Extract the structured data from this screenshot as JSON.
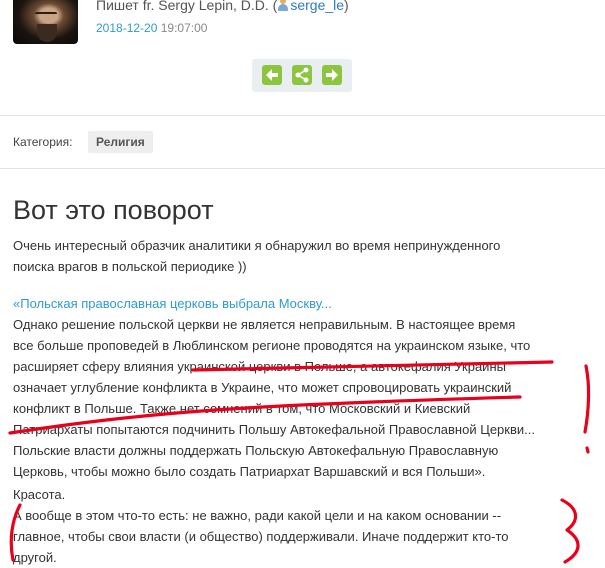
{
  "author": {
    "prefix": "Пишет fr. Sergy Lepin, D.D. (",
    "username": "serge_le",
    "suffix": ")",
    "date": "2018-12-20",
    "time": "19:07:00"
  },
  "share_bar": {
    "prev_icon": "arrow-left-icon",
    "share_icon": "share-icon",
    "next_icon": "arrow-right-icon",
    "accent": "#8cc63f"
  },
  "category": {
    "label": "Категория:",
    "value": "Религия"
  },
  "post": {
    "title": "Вот это поворот",
    "intro_lines": [
      "Очень интересный образчик аналитики я обнаружил во время непринужденного",
      "поиска врагов в польской периодике ))"
    ],
    "quote_link": "«Польская православная церковь выбрала Москву...",
    "quote_lines": [
      "Однако решение польской церкви не является неправильным. В настоящее время",
      "все больше проповедей в Люблинском регионе проводятся на украинском языке, что",
      "расширяет сферу влияния украинской церкви в Польше, а автокефалия Украины",
      "означает углубление конфликта в Украине, что может спровоцировать украинский",
      "конфликт в Польше. Также нет сомнений в том, что Московский и Киевский",
      "Патриархаты попытаются подчинить Польшу Автокефальной Православной Церкви...",
      "Польские власти должны поддержать Польскую Автокефальную Православную",
      "Церковь, чтобы можно было создать Патриархат Варшавский и вся Польши»."
    ],
    "closing_lines": [
      "Красота.",
      "А вообще в этом что-то есть: не важно, ради какой цели и на каком основании --",
      "главное, чтобы свои власти (и общество) поддерживали. Иначе поддержит кто-то",
      "другой."
    ]
  },
  "annotations": {
    "marker_color": "#e8001c"
  }
}
